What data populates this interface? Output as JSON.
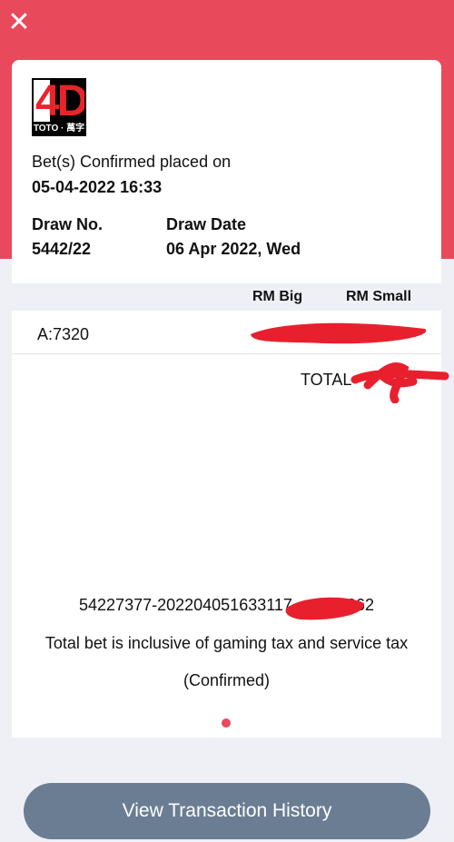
{
  "header": {
    "close_icon": "close-icon",
    "close_glyph": "✕",
    "accent_color": "#e84a5c"
  },
  "logo": {
    "top_text": "4D",
    "bottom_text": "TOTO · 萬字"
  },
  "confirmation": {
    "label": "Bet(s) Confirmed placed on",
    "datetime": "05-04-2022 16:33"
  },
  "draw": {
    "number_label": "Draw No.",
    "number_value": "5442/22",
    "date_label": "Draw Date",
    "date_value": "06 Apr 2022, Wed"
  },
  "bets": {
    "columns": [
      "RM Big",
      "RM Small"
    ],
    "rows": [
      {
        "number": "A:7320"
      }
    ],
    "total_label": "TOTAL"
  },
  "footer_info": {
    "reference_number": "54227377-202204051633117",
    "reference_suffix": "862",
    "tax_note": "Total bet is inclusive of gaming tax and service tax",
    "status": "(Confirmed)"
  },
  "actions": {
    "history_button": "View Transaction History"
  }
}
